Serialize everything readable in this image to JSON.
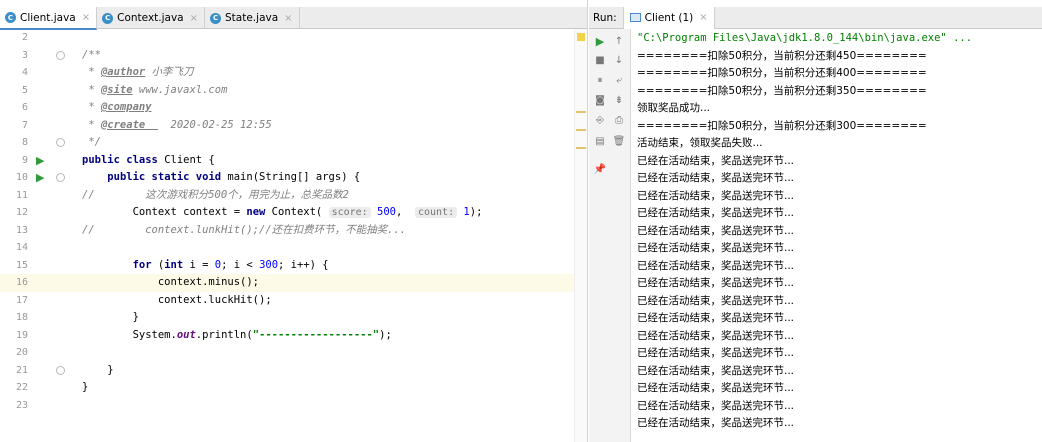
{
  "editor": {
    "tabs": [
      {
        "label": "Client.java",
        "close": "×"
      },
      {
        "label": "Context.java",
        "close": "×"
      },
      {
        "label": "State.java",
        "close": "×"
      }
    ],
    "tab_icon": "C",
    "lines": [
      {
        "n": "2",
        "html": ""
      },
      {
        "n": "3",
        "html": "<span class=\"cm\">/**</span>"
      },
      {
        "n": "4",
        "html": "<span class=\"cm\"> * </span><span class=\"tag\">@author</span><span class=\"cm\"> 小李飞刀</span>"
      },
      {
        "n": "5",
        "html": "<span class=\"cm\"> * </span><span class=\"tag\">@site</span><span class=\"cm\"> www.javaxl.com</span>"
      },
      {
        "n": "6",
        "html": "<span class=\"cm\"> * </span><span class=\"tag\">@company</span>"
      },
      {
        "n": "7",
        "html": "<span class=\"cm\"> * </span><span class=\"tag\">@create  </span><span class=\"cm\">  2020-02-25 12:55</span>"
      },
      {
        "n": "8",
        "html": "<span class=\"cm\"> */</span>"
      },
      {
        "n": "9",
        "html": "<span class=\"kw\">public class </span>Client {"
      },
      {
        "n": "10",
        "html": "    <span class=\"kw\">public static void </span>main(String[] args) {"
      },
      {
        "n": "11",
        "html": "<span class=\"cm\">//        这次游戏积分500个，用完为止，总奖品数2</span>"
      },
      {
        "n": "12",
        "html": "        Context context = <span class=\"kw\">new </span>Context( <span class=\"hint\">score:</span> <span class=\"num\">500</span>,  <span class=\"hint\">count:</span> <span class=\"num\">1</span>);"
      },
      {
        "n": "13",
        "html": "<span class=\"cm\">//        context.lunkHit();//还在扣费环节，不能抽奖...</span>"
      },
      {
        "n": "14",
        "html": ""
      },
      {
        "n": "15",
        "html": "        <span class=\"kw\">for </span>(<span class=\"kw\">int </span>i = <span class=\"num\">0</span>; i &lt; <span class=\"num\">300</span>; i++) {"
      },
      {
        "n": "16",
        "html": "            context.minus();"
      },
      {
        "n": "17",
        "html": "            context.luckHit();"
      },
      {
        "n": "18",
        "html": "        }"
      },
      {
        "n": "19",
        "html": "        System.<span class=\"fld\">out</span>.println(<span class=\"str\">\"------------------\"</span>);"
      },
      {
        "n": "20",
        "html": ""
      },
      {
        "n": "21",
        "html": "    }"
      },
      {
        "n": "22",
        "html": "}"
      },
      {
        "n": "23",
        "html": ""
      }
    ]
  },
  "run": {
    "label": "Run:",
    "tab_label": "Client (1)",
    "tab_close": "×",
    "output": [
      "\"C:\\Program Files\\Java\\jdk1.8.0_144\\bin\\java.exe\" ...",
      "========扣除50积分，当前积分还剩450========",
      "========扣除50积分，当前积分还剩400========",
      "========扣除50积分，当前积分还剩350========",
      "领取奖品成功...",
      "========扣除50积分，当前积分还剩300========",
      "活动结束，领取奖品失败...",
      "已经在活动结束，奖品送完环节...",
      "已经在活动结束，奖品送完环节...",
      "已经在活动结束，奖品送完环节...",
      "已经在活动结束，奖品送完环节...",
      "已经在活动结束，奖品送完环节...",
      "已经在活动结束，奖品送完环节...",
      "已经在活动结束，奖品送完环节...",
      "已经在活动结束，奖品送完环节...",
      "已经在活动结束，奖品送完环节...",
      "已经在活动结束，奖品送完环节...",
      "已经在活动结束，奖品送完环节...",
      "已经在活动结束，奖品送完环节...",
      "已经在活动结束，奖品送完环节...",
      "已经在活动结束，奖品送完环节...",
      "已经在活动结束，奖品送完环节...",
      "已经在活动结束，奖品送完环节..."
    ]
  }
}
